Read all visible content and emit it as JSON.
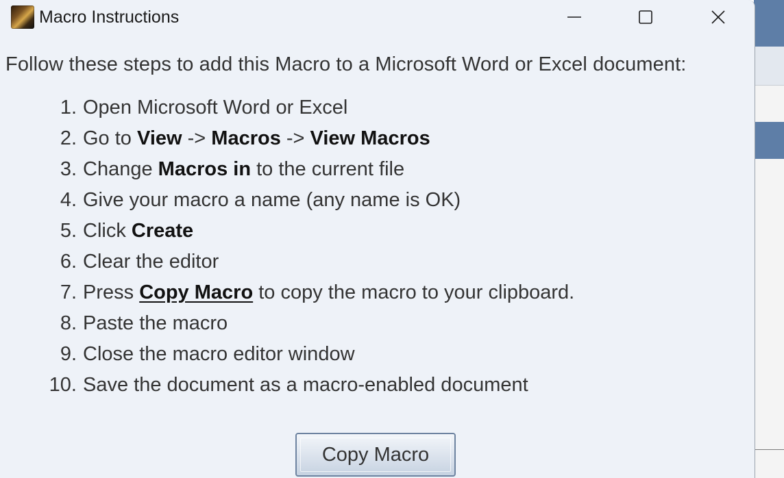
{
  "window": {
    "title": "Macro Instructions",
    "app_icon": "app-photo-icon",
    "controls": {
      "minimize_icon": "minimize-icon",
      "maximize_icon": "maximize-icon",
      "close_icon": "close-icon"
    }
  },
  "intro": "Follow these steps to add this Macro to a Microsoft Word or Excel document:",
  "steps": [
    {
      "num": "1.",
      "parts": [
        {
          "t": "Open Microsoft Word or Excel"
        }
      ]
    },
    {
      "num": "2.",
      "parts": [
        {
          "t": "Go to "
        },
        {
          "t": "View",
          "b": true
        },
        {
          "t": " -> "
        },
        {
          "t": "Macros",
          "b": true
        },
        {
          "t": " -> "
        },
        {
          "t": "View Macros",
          "b": true
        }
      ]
    },
    {
      "num": "3.",
      "parts": [
        {
          "t": "Change "
        },
        {
          "t": "Macros in",
          "b": true
        },
        {
          "t": " to the current file"
        }
      ]
    },
    {
      "num": "4.",
      "parts": [
        {
          "t": "Give your macro a name (any name is OK)"
        }
      ]
    },
    {
      "num": "5.",
      "parts": [
        {
          "t": "Click "
        },
        {
          "t": "Create",
          "b": true
        }
      ]
    },
    {
      "num": "6.",
      "parts": [
        {
          "t": "Clear the editor"
        }
      ]
    },
    {
      "num": "7.",
      "parts": [
        {
          "t": "Press "
        },
        {
          "t": "Copy Macro",
          "u": true
        },
        {
          "t": " to copy the macro to your clipboard."
        }
      ]
    },
    {
      "num": "8.",
      "parts": [
        {
          "t": "Paste the macro"
        }
      ]
    },
    {
      "num": "9.",
      "parts": [
        {
          "t": "Close the macro editor window"
        }
      ]
    },
    {
      "num": "10.",
      "parts": [
        {
          "t": "Save the document as a macro-enabled document"
        }
      ]
    }
  ],
  "copy_button_label": "Copy Macro",
  "colors": {
    "window_bg": "#eef2f8",
    "text": "#333333",
    "button_border": "#6d83a0",
    "background_accent": "#5e7ea7"
  }
}
